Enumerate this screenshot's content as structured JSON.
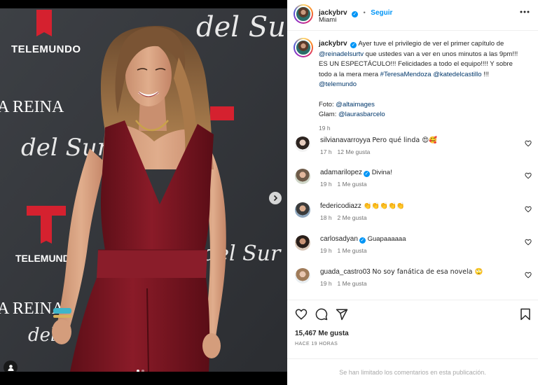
{
  "post": {
    "username": "jackybrv",
    "follow_label": "Seguir",
    "location": "Miami",
    "separator": "•"
  },
  "caption": {
    "username": "jackybrv",
    "t1": "Ayer tuve el privilegio de ver el primer capítulo de ",
    "m1": "@reinadelsurtv",
    "t2": " que ustedes van a ver en unos minutos a las 9pm!!! ES UN ESPECTÁCULO!!! Felicidades a todo el equipo!!!! Y sobre todo a la mera mera ",
    "h1": "#TeresaMendoza",
    "m2": "@katedelcastillo",
    "t3": " !!! ",
    "m3": "@telemundo",
    "foto_label": "Foto: ",
    "foto_handle": "@altaimages",
    "glam_label": "Glam: ",
    "glam_handle": "@laurasbarcelo",
    "time": "19 h"
  },
  "comments": [
    {
      "username": "silvianavarroyya",
      "verified": false,
      "text": "Pero qué linda 😍🥰",
      "time": "17 h",
      "likes": "12 Me gusta"
    },
    {
      "username": "adamarilopez",
      "verified": true,
      "text": "Divina!",
      "time": "19 h",
      "likes": "1 Me gusta"
    },
    {
      "username": "federicodiazz",
      "verified": false,
      "text": "👏👏👏👏👏",
      "time": "18 h",
      "likes": "2 Me gusta"
    },
    {
      "username": "carlosadyan",
      "verified": true,
      "text": "Guapaaaaaa",
      "time": "19 h",
      "likes": "1 Me gusta"
    },
    {
      "username": "guada_castro03",
      "verified": false,
      "text": "No soy fanática de esa novela 🙄",
      "time": "19 h",
      "likes": "1 Me gusta"
    }
  ],
  "actions": {
    "likes": "15,467 Me gusta",
    "posted_ago": "HACE 19 HORAS",
    "comments_limited": "Se han limitado los comentarios en esta publicación."
  },
  "media": {
    "backdrop_texts": [
      "TELEMUNDO",
      "del Sur",
      "A REINA",
      "del Sur",
      "TELEMUNDO",
      "del Sur",
      "A REINA",
      "del"
    ],
    "carousel_count": 2,
    "carousel_active": 1
  },
  "icons": [
    "more-icon",
    "heart-icon",
    "comment-icon",
    "share-icon",
    "bookmark-icon",
    "chevron-right-icon",
    "user-tag-icon",
    "verified-icon"
  ],
  "colors": {
    "accent": "#0095f6",
    "link": "#00376b",
    "brand_red": "#d5212f",
    "dress": "#7c1723"
  }
}
